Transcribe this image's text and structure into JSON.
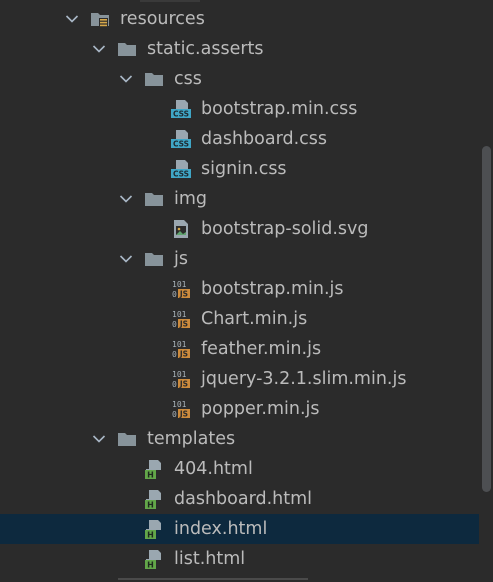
{
  "tree": [
    {
      "label": "resources",
      "icon": "resources-folder-icon",
      "depth": 0,
      "expanded": true
    },
    {
      "label": "static.asserts",
      "icon": "folder-icon",
      "depth": 1,
      "expanded": true
    },
    {
      "label": "css",
      "icon": "folder-icon",
      "depth": 2,
      "expanded": true
    },
    {
      "label": "bootstrap.min.css",
      "icon": "css-file-icon",
      "depth": 3
    },
    {
      "label": "dashboard.css",
      "icon": "css-file-icon",
      "depth": 3
    },
    {
      "label": "signin.css",
      "icon": "css-file-icon",
      "depth": 3
    },
    {
      "label": "img",
      "icon": "folder-icon",
      "depth": 2,
      "expanded": true
    },
    {
      "label": "bootstrap-solid.svg",
      "icon": "image-file-icon",
      "depth": 3
    },
    {
      "label": "js",
      "icon": "folder-icon",
      "depth": 2,
      "expanded": true
    },
    {
      "label": "bootstrap.min.js",
      "icon": "js-file-icon",
      "depth": 3
    },
    {
      "label": "Chart.min.js",
      "icon": "js-file-icon",
      "depth": 3
    },
    {
      "label": "feather.min.js",
      "icon": "js-file-icon",
      "depth": 3
    },
    {
      "label": "jquery-3.2.1.slim.min.js",
      "icon": "js-file-icon",
      "depth": 3
    },
    {
      "label": "popper.min.js",
      "icon": "js-file-icon",
      "depth": 3
    },
    {
      "label": "templates",
      "icon": "folder-icon",
      "depth": 1,
      "expanded": true
    },
    {
      "label": "404.html",
      "icon": "html-file-icon",
      "depth": 2
    },
    {
      "label": "dashboard.html",
      "icon": "html-file-icon",
      "depth": 2
    },
    {
      "label": "index.html",
      "icon": "html-file-icon",
      "depth": 2,
      "selected": true
    },
    {
      "label": "list.html",
      "icon": "html-file-icon",
      "depth": 2
    }
  ],
  "colors": {
    "background": "#2b2b2b",
    "text": "#bbbbbb",
    "selected_row": "#0d293e",
    "folder": "#87939a",
    "css_badge": "#40a6c6",
    "js_badge": "#cc8a3c",
    "html_badge": "#62a649",
    "scroll_thumb": "#4d4f52"
  }
}
